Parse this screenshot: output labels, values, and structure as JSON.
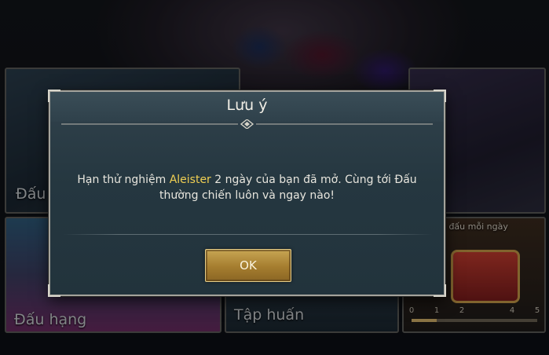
{
  "dialog": {
    "title": "Lưu ý",
    "message_before": "Hạn thử nghiệm ",
    "hero_name": "Aleister",
    "message_after": " 2 ngày của bạn đã mở. Cùng tới Đấu thường chiến luôn và ngay nào!",
    "ok_label": "OK"
  },
  "lobby": {
    "partial_label": "Đấu",
    "ranked_label": "Đấu hạng",
    "training_label": "Tập huấn",
    "daily_label": "ng đấu mỗi ngày",
    "daily_progress_ticks": [
      "0",
      "1",
      "2",
      "4",
      "5"
    ],
    "daily_progress": 0.2
  },
  "colors": {
    "accent_gold": "#f0cf52",
    "button_gold": "#b08a3a",
    "dialog_bg": "#2a3b44"
  }
}
